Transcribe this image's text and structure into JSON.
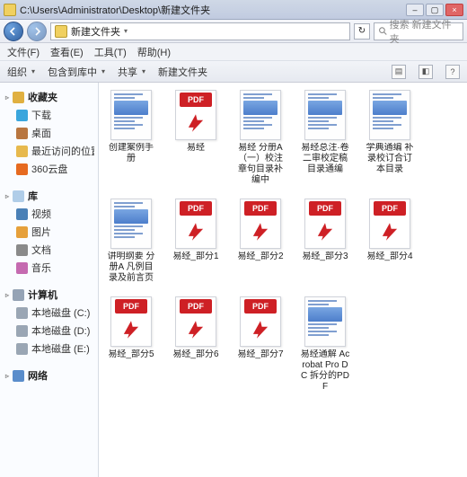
{
  "window": {
    "title_path": "C:\\Users\\Administrator\\Desktop\\新建文件夹"
  },
  "address": {
    "path_display": "新建文件夹",
    "search_placeholder": "搜索 新建文件夹"
  },
  "menu": {
    "file": "文件(F)",
    "edit": "查看(E)",
    "tools": "工具(T)",
    "help": "帮助(H)"
  },
  "toolbar": {
    "organize": "组织",
    "include": "包含到库中",
    "share": "共享",
    "new_folder": "新建文件夹"
  },
  "sidebar": {
    "favorites": {
      "head": "收藏夹",
      "items": [
        "下载",
        "桌面",
        "最近访问的位置",
        "360云盘"
      ]
    },
    "libraries": {
      "head": "库",
      "items": [
        "视频",
        "图片",
        "文档",
        "音乐"
      ]
    },
    "computer": {
      "head": "计算机",
      "items": [
        "本地磁盘 (C:)",
        "本地磁盘 (D:)",
        "本地磁盘 (E:)"
      ]
    },
    "network": {
      "head": "网络"
    }
  },
  "files": [
    {
      "name": "创建案例手册",
      "kind": "doc"
    },
    {
      "name": "易经",
      "kind": "pdf"
    },
    {
      "name": "易经 分册A（一）校注章句目录补编中",
      "kind": "doc"
    },
    {
      "name": "易经总注·卷二审校定稿目录通编",
      "kind": "doc"
    },
    {
      "name": "学典通编 补录校订合订本目录",
      "kind": "doc"
    },
    {
      "name": "讲明纲要 分册A 凡例目录及前言页",
      "kind": "doc"
    },
    {
      "name": "易经_部分1",
      "kind": "pdf"
    },
    {
      "name": "易经_部分2",
      "kind": "pdf"
    },
    {
      "name": "易经_部分3",
      "kind": "pdf"
    },
    {
      "name": "易经_部分4",
      "kind": "pdf"
    },
    {
      "name": "易经_部分5",
      "kind": "pdf"
    },
    {
      "name": "易经_部分6",
      "kind": "pdf"
    },
    {
      "name": "易经_部分7",
      "kind": "pdf"
    },
    {
      "name": "易经通解 Acrobat Pro DC 拆分的PDF",
      "kind": "doc"
    }
  ],
  "pdf_label": "PDF"
}
